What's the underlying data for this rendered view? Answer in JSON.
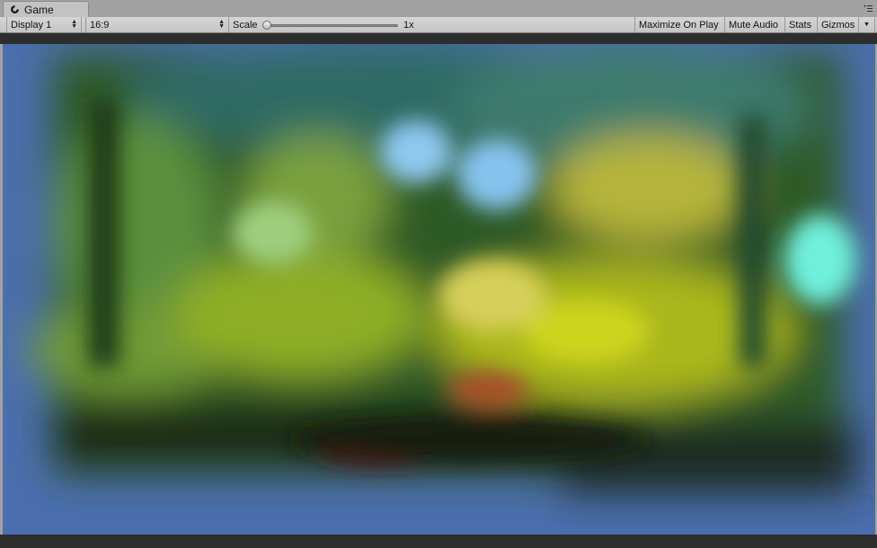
{
  "tab": {
    "title": "Game",
    "icon": "unity-logo-icon"
  },
  "tab_menu": {
    "icon": "context-menu-icon"
  },
  "toolbar": {
    "display_label": "Display 1",
    "aspect_label": "16:9",
    "scale_label": "Scale",
    "scale_value": "1x",
    "scale_slider_fraction": 0.0,
    "maximize_label": "Maximize On Play",
    "mute_label": "Mute Audio",
    "stats_label": "Stats",
    "gizmos_label": "Gizmos"
  },
  "game_view": {
    "background_color": "#4b6fae",
    "content": "blurred jungle scene"
  },
  "colors": {
    "toolbar_bg": "#cbcbcb",
    "window_bg": "#a2a2a2",
    "letterbox": "#2d2d2d",
    "viewport_blue": "#4b6fae"
  }
}
